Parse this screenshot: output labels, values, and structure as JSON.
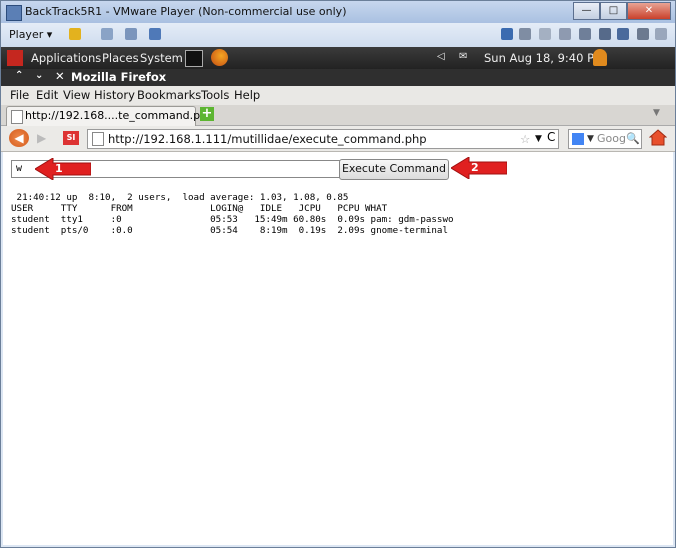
{
  "vmware": {
    "title": "BackTrack5R1 - VMware Player (Non-commercial use only)",
    "player_menu": "Player",
    "controls": {
      "minimize": "—",
      "maximize": "□",
      "close": "✕"
    }
  },
  "gnome_panel": {
    "menus": [
      "Applications",
      "Places",
      "System"
    ],
    "datetime": "Sun Aug 18,  9:40 PM"
  },
  "firefox": {
    "window_title": "Mozilla Firefox",
    "menu": [
      "File",
      "Edit",
      "View",
      "History",
      "Bookmarks",
      "Tools",
      "Help"
    ],
    "tab_label": "http://192.168....te_command.php",
    "url": "http://192.168.1.111/mutillidae/execute_command.php",
    "search_placeholder": "Goog"
  },
  "page": {
    "command_value": "w",
    "execute_label": "Execute Command",
    "output_lines": [
      " 21:40:12 up  8:10,  2 users,  load average: 1.03, 1.08, 0.85",
      "USER     TTY      FROM              LOGIN@   IDLE   JCPU   PCPU WHAT",
      "student  tty1     :0                05:53   15:49m 60.80s  0.09s pam: gdm-passwo",
      "student  pts/0    :0.0              05:54    8:19m  0.19s  2.09s gnome-terminal"
    ]
  },
  "annotations": {
    "callout_1": "1",
    "callout_2": "2",
    "color": "#e02020"
  }
}
